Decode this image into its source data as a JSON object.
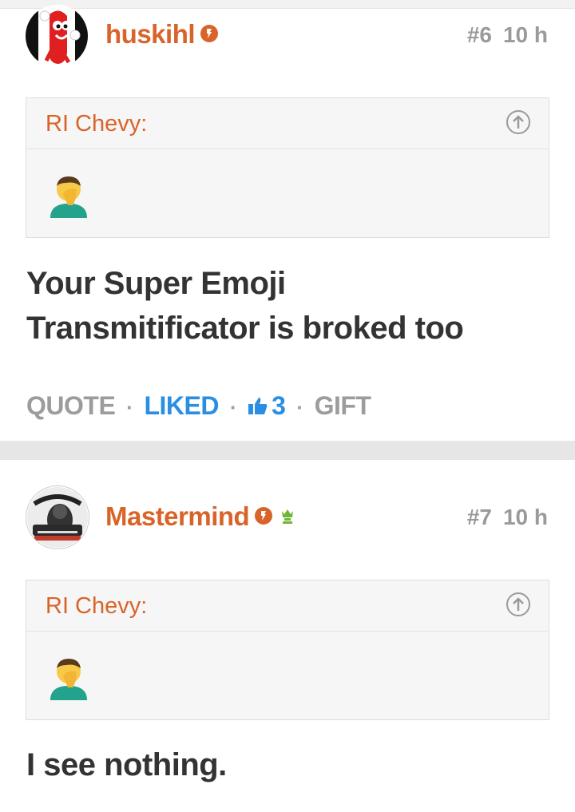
{
  "posts": [
    {
      "username": "huskihl",
      "post_number": "#6",
      "time": "10 h",
      "quote": {
        "author": "RI Chevy:"
      },
      "text_line1": "Your Super Emoji",
      "text_line2": "Transmitificator is broked too",
      "actions": {
        "quote": "QUOTE",
        "liked": "LIKED",
        "like_count": "3",
        "gift": "GIFT",
        "separator": "·"
      },
      "avatar_icon": "hotdog-mascot-icon"
    },
    {
      "username": "Mastermind",
      "post_number": "#7",
      "time": "10 h",
      "quote": {
        "author": "RI Chevy:"
      },
      "text_line1": "I see nothing.",
      "avatar_icon": "mastermind-logo-icon"
    }
  ],
  "colors": {
    "accent": "#d9642a",
    "link_blue": "#2a8fe3",
    "muted": "#9a9a9a",
    "badge_green": "#6fb536"
  }
}
